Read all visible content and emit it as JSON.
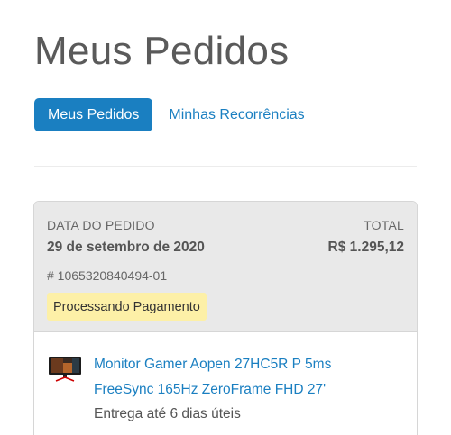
{
  "page": {
    "title": "Meus Pedidos"
  },
  "tabs": {
    "active_label": "Meus Pedidos",
    "secondary_label": "Minhas Recorrências"
  },
  "order": {
    "date_label": "DATA DO PEDIDO",
    "date_value": "29 de setembro de 2020",
    "total_label": "TOTAL",
    "total_value": "R$ 1.295,12",
    "number": "# 1065320840494-01",
    "status": "Processando Pagamento",
    "item": {
      "thumbnail_icon": "monitor-icon",
      "title": "Monitor Gamer Aopen 27HC5R P 5ms FreeSync 165Hz ZeroFrame FHD 27'",
      "delivery": "Entrega até 6 dias úteis"
    }
  },
  "colors": {
    "accent": "#1a7fc1",
    "status_badge": "#fdf0a7",
    "card_header": "#e9e9e9"
  }
}
